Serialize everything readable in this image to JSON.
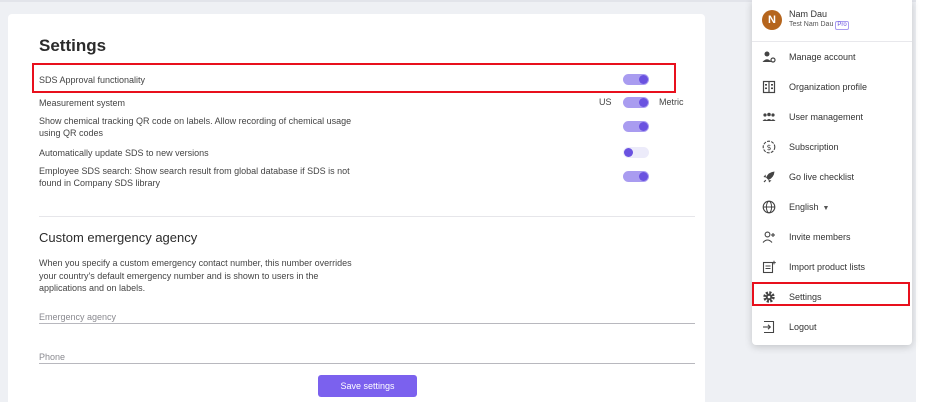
{
  "settings": {
    "title": "Settings",
    "sds_approval": {
      "label": "SDS Approval functionality",
      "enabled": true
    },
    "measurement": {
      "label": "Measurement system",
      "left_unit": "US",
      "right_unit": "Metric",
      "value": "Metric"
    },
    "qr_tracking": {
      "label": "Show chemical tracking QR code on labels. Allow recording of chemical usage using QR codes",
      "enabled": true
    },
    "auto_update": {
      "label": "Automatically update SDS to new versions",
      "enabled": false
    },
    "employee_search": {
      "label": "Employee SDS search: Show search result from global database if SDS is not found in Company SDS library",
      "enabled": true
    }
  },
  "emergency": {
    "title": "Custom emergency agency",
    "description": "When you specify a custom emergency contact number, this number overrides your country's default emergency number and is shown to users in the applications and on labels.",
    "agency_placeholder": "Emergency agency",
    "phone_placeholder": "Phone"
  },
  "save_label": "Save settings",
  "menu": {
    "user": {
      "initial": "N",
      "name": "Nam Dau",
      "org": "Test Nam Dau",
      "badge": "Pro"
    },
    "items": [
      {
        "label": "Manage account",
        "icon": "manage-account-icon"
      },
      {
        "label": "Organization profile",
        "icon": "building-icon"
      },
      {
        "label": "User management",
        "icon": "users-icon"
      },
      {
        "label": "Subscription",
        "icon": "dollar-icon"
      },
      {
        "label": "Go live checklist",
        "icon": "rocket-icon"
      },
      {
        "label": "English",
        "icon": "globe-icon"
      },
      {
        "label": "Invite members",
        "icon": "add-person-icon"
      },
      {
        "label": "Import product lists",
        "icon": "import-list-icon"
      },
      {
        "label": "Settings",
        "icon": "gear-icon"
      },
      {
        "label": "Logout",
        "icon": "logout-icon"
      }
    ]
  },
  "colors": {
    "accent": "#6a52e0",
    "highlight": "#e8101d",
    "avatar": "#b5651d"
  }
}
